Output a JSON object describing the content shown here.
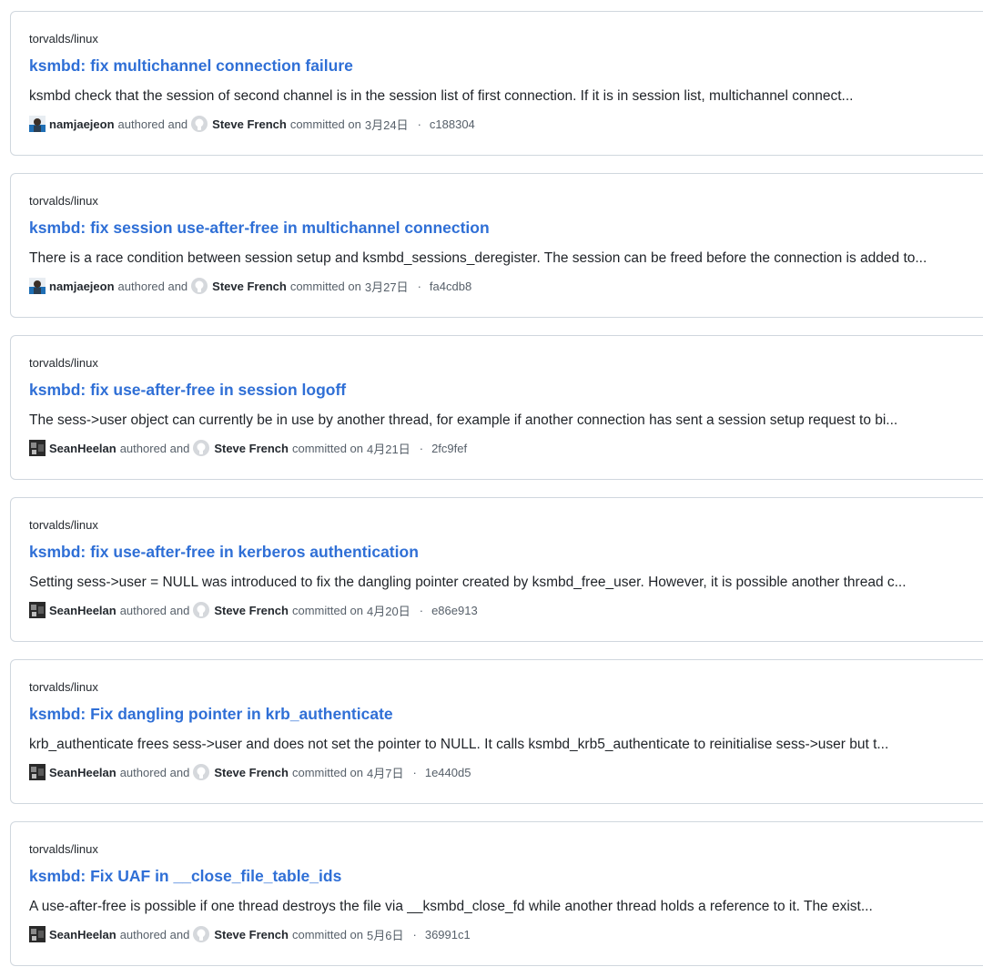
{
  "commits": [
    {
      "repo": "torvalds/linux",
      "title": "ksmbd: fix multichannel connection failure",
      "message": "ksmbd check that the session of second channel is in the session list of first connection. If it is in session list, multichannel connect...",
      "author": "namjaejeon",
      "author_avatar": "namjaejeon-avatar",
      "authored_text": "authored and",
      "committer": "Steve French",
      "committed_text": "committed on",
      "date": "3月24日",
      "separator": "·",
      "sha": "c188304"
    },
    {
      "repo": "torvalds/linux",
      "title": "ksmbd: fix session use-after-free in multichannel connection",
      "message": "There is a race condition between session setup and ksmbd_sessions_deregister. The session can be freed before the connection is added to...",
      "author": "namjaejeon",
      "author_avatar": "namjaejeon-avatar",
      "authored_text": "authored and",
      "committer": "Steve French",
      "committed_text": "committed on",
      "date": "3月27日",
      "separator": "·",
      "sha": "fa4cdb8"
    },
    {
      "repo": "torvalds/linux",
      "title": "ksmbd: fix use-after-free in session logoff",
      "message": "The sess->user object can currently be in use by another thread, for example if another connection has sent a session setup request to bi...",
      "author": "SeanHeelan",
      "author_avatar": "seanheelan-avatar",
      "authored_text": "authored and",
      "committer": "Steve French",
      "committed_text": "committed on",
      "date": "4月21日",
      "separator": "·",
      "sha": "2fc9fef"
    },
    {
      "repo": "torvalds/linux",
      "title": "ksmbd: fix use-after-free in kerberos authentication",
      "message": "Setting sess->user = NULL was introduced to fix the dangling pointer created by ksmbd_free_user. However, it is possible another thread c...",
      "author": "SeanHeelan",
      "author_avatar": "seanheelan-avatar",
      "authored_text": "authored and",
      "committer": "Steve French",
      "committed_text": "committed on",
      "date": "4月20日",
      "separator": "·",
      "sha": "e86e913"
    },
    {
      "repo": "torvalds/linux",
      "title": "ksmbd: Fix dangling pointer in krb_authenticate",
      "message": "krb_authenticate frees sess->user and does not set the pointer to NULL. It calls ksmbd_krb5_authenticate to reinitialise sess->user but t...",
      "author": "SeanHeelan",
      "author_avatar": "seanheelan-avatar",
      "authored_text": "authored and",
      "committer": "Steve French",
      "committed_text": "committed on",
      "date": "4月7日",
      "separator": "·",
      "sha": "1e440d5"
    },
    {
      "repo": "torvalds/linux",
      "title": "ksmbd: Fix UAF in __close_file_table_ids",
      "message": "A use-after-free is possible if one thread destroys the file via __ksmbd_close_fd while another thread holds a reference to it. The exist...",
      "author": "SeanHeelan",
      "author_avatar": "seanheelan-avatar",
      "authored_text": "authored and",
      "committer": "Steve French",
      "committed_text": "committed on",
      "date": "5月6日",
      "separator": "·",
      "sha": "36991c1"
    }
  ],
  "colors": {
    "title_link": "#2f6fd6",
    "border": "#d0d7de",
    "muted": "#57606a",
    "text": "#1f2328"
  }
}
